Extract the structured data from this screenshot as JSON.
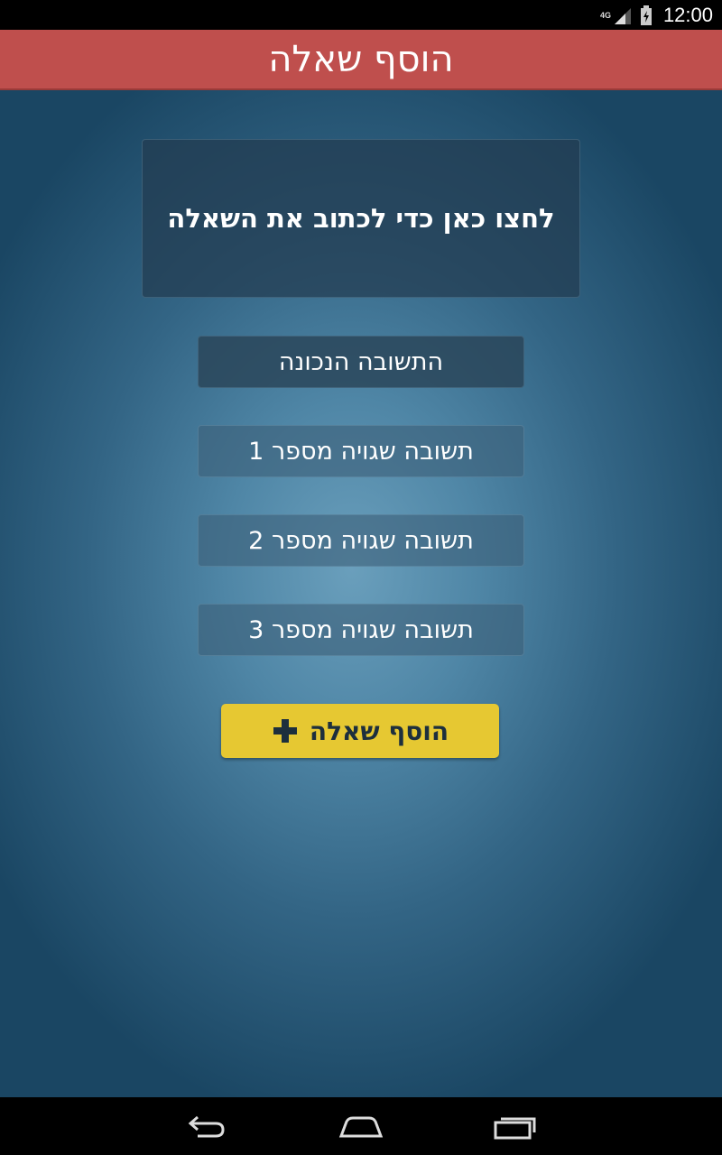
{
  "status_bar": {
    "network": "4G",
    "time": "12:00"
  },
  "header": {
    "title": "הוסף שאלה"
  },
  "question": {
    "placeholder": "לחצו כאן כדי לכתוב את השאלה"
  },
  "answers": {
    "correct": "התשובה הנכונה",
    "wrong": [
      "תשובה שגויה מספר 1",
      "תשובה שגויה מספר 2",
      "תשובה שגויה מספר 3"
    ]
  },
  "add_button": {
    "label": "הוסף שאלה",
    "icon": "plus-icon",
    "color": "#e6c832"
  },
  "colors": {
    "header": "#bf4f4d",
    "background_center": "#6a9fbc",
    "background_edge": "#1a4663"
  },
  "nav_icons": [
    "back-icon",
    "home-icon",
    "recent-apps-icon"
  ]
}
